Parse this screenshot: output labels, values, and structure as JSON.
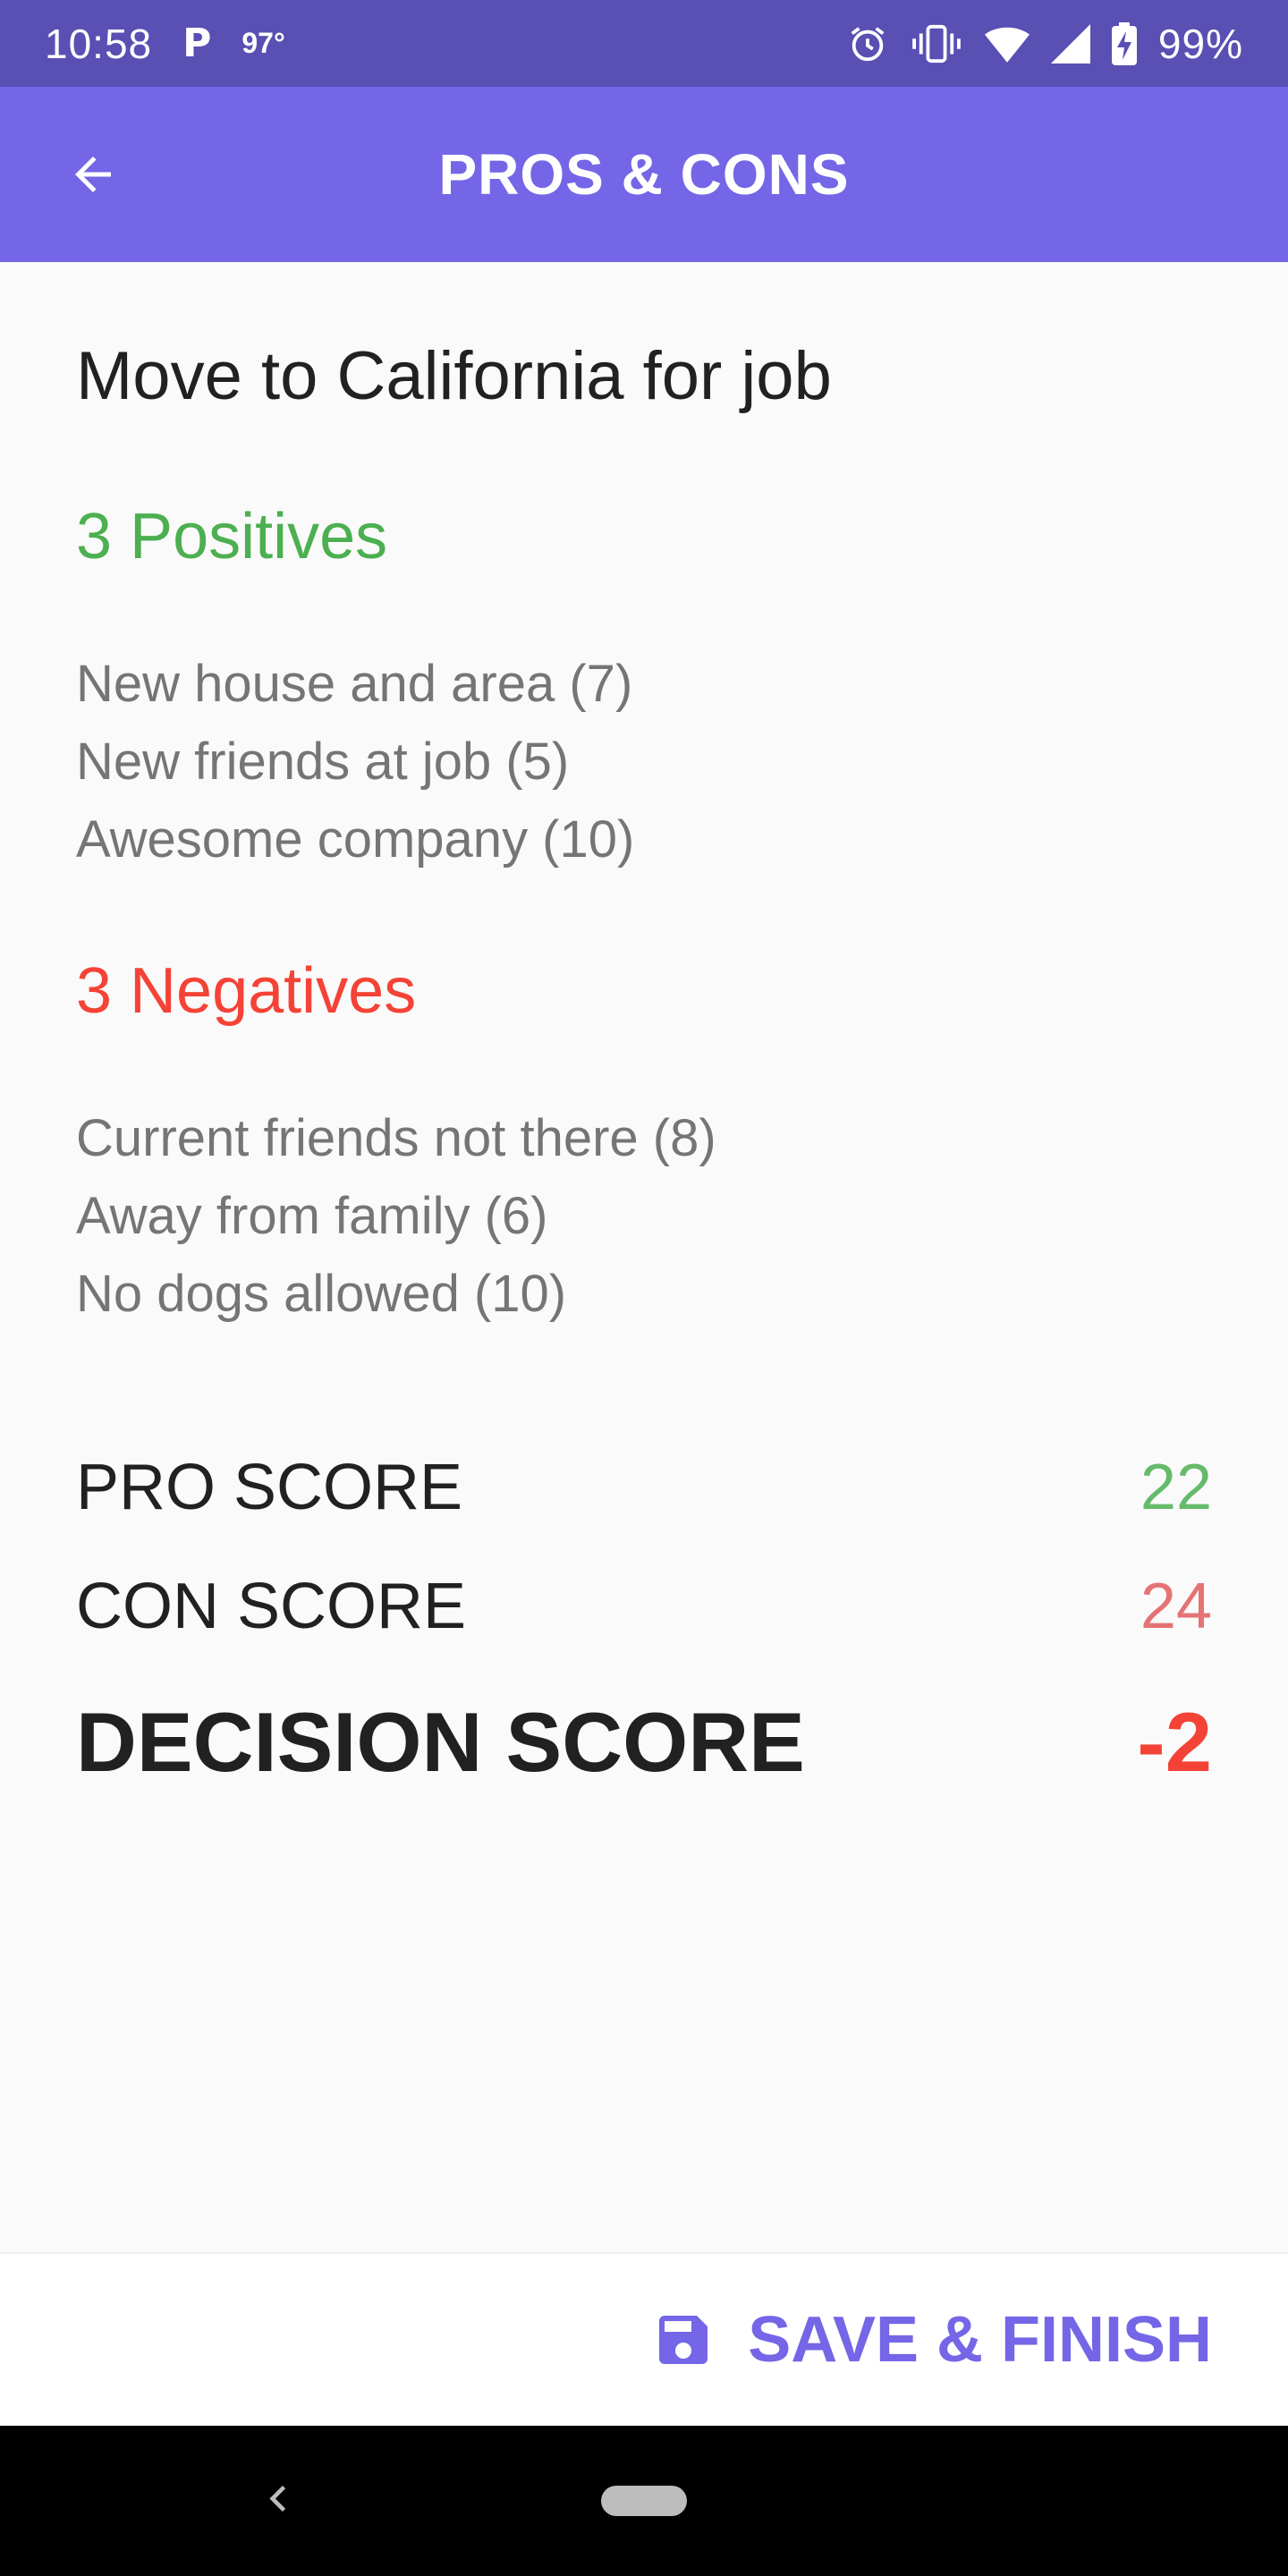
{
  "status_bar": {
    "time": "10:58",
    "notification_p": "P",
    "temperature": "97°",
    "battery": "99%",
    "icons": [
      "alarm-icon",
      "vibrate-icon",
      "wifi-icon",
      "cell-signal-icon",
      "battery-charging-icon"
    ]
  },
  "app_bar": {
    "title": "PROS & CONS",
    "back_icon": "arrow-back-icon"
  },
  "decision": {
    "title": "Move to California for job"
  },
  "positives": {
    "heading": "3 Positives",
    "items": [
      "New house and area (7)",
      "New friends at job (5)",
      "Awesome company (10)"
    ]
  },
  "negatives": {
    "heading": "3 Negatives",
    "items": [
      "Current friends not there (8)",
      "Away from family (6)",
      "No dogs allowed (10)"
    ]
  },
  "scores": {
    "pro_label": "PRO SCORE",
    "pro_value": "22",
    "con_label": "CON SCORE",
    "con_value": "24",
    "decision_label": "DECISION SCORE",
    "decision_value": "-2"
  },
  "actions": {
    "save_label": "SAVE & FINISH",
    "save_icon": "save-icon"
  },
  "colors": {
    "status_bar": "#5a4fb3",
    "app_bar": "#7466e6",
    "positive": "#4caf50",
    "negative": "#f44336",
    "accent": "#7466e6"
  }
}
